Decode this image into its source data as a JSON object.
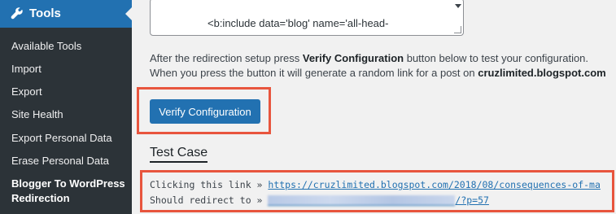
{
  "sidebar": {
    "menu_title": "Tools",
    "items": [
      {
        "label": "Available Tools"
      },
      {
        "label": "Import"
      },
      {
        "label": "Export"
      },
      {
        "label": "Site Health"
      },
      {
        "label": "Export Personal Data"
      },
      {
        "label": "Erase Personal Data"
      },
      {
        "label": "Blogger To WordPress"
      },
      {
        "label": "Redirection"
      }
    ],
    "current_item": "Blogger To WordPress Redirection"
  },
  "main": {
    "code_excerpt": "<b:include data='blog' name='all-head-",
    "desc_line1_pre": "After the redirection setup press ",
    "desc_line1_bold": "Verify Configuration",
    "desc_line1_post": " button below to test your configuration.",
    "desc_line2_pre": "When you press the button it will generate a random link for a post on ",
    "desc_line2_bold": "cruzlimited.blogspot.com",
    "verify_button": "Verify Configuration",
    "test_case_title": "Test Case",
    "test_case": {
      "line1_label": "Clicking this link » ",
      "line1_link": "https://cruzlimited.blogspot.com/2018/08/consequences-of-ma",
      "line2_label": "Should redirect to » ",
      "line2_link_suffix": "/?p=57"
    }
  },
  "colors": {
    "sidebar_bg": "#2c3338",
    "active_menu": "#2271b1",
    "highlight_border": "#e8553e",
    "link": "#2271b1"
  }
}
